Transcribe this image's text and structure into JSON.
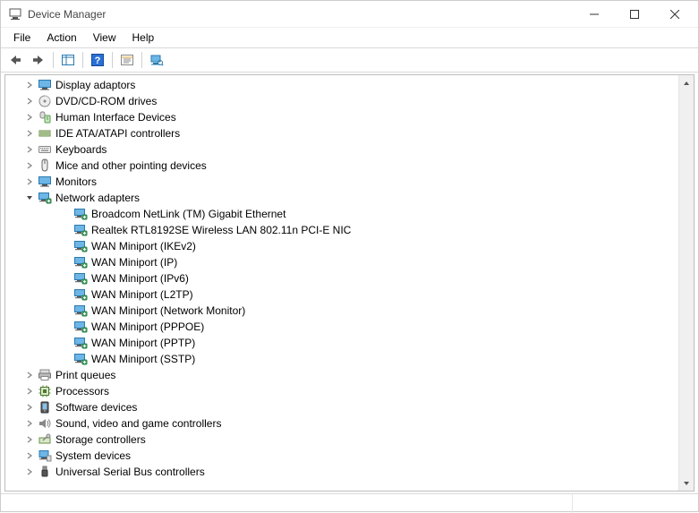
{
  "window": {
    "title": "Device Manager"
  },
  "menu": {
    "file": "File",
    "action": "Action",
    "view": "View",
    "help": "Help"
  },
  "tree": {
    "categories": [
      {
        "label": "Display adaptors",
        "icon": "monitor",
        "expanded": false,
        "children": []
      },
      {
        "label": "DVD/CD-ROM drives",
        "icon": "disc",
        "expanded": false,
        "children": []
      },
      {
        "label": "Human Interface Devices",
        "icon": "hid",
        "expanded": false,
        "children": []
      },
      {
        "label": "IDE ATA/ATAPI controllers",
        "icon": "ide",
        "expanded": false,
        "children": []
      },
      {
        "label": "Keyboards",
        "icon": "keyboard",
        "expanded": false,
        "children": []
      },
      {
        "label": "Mice and other pointing devices",
        "icon": "mouse",
        "expanded": false,
        "children": []
      },
      {
        "label": "Monitors",
        "icon": "monitor",
        "expanded": false,
        "children": []
      },
      {
        "label": "Network adapters",
        "icon": "net",
        "expanded": true,
        "children": [
          {
            "label": "Broadcom NetLink (TM) Gigabit Ethernet",
            "icon": "net"
          },
          {
            "label": "Realtek RTL8192SE Wireless LAN 802.11n PCI-E NIC",
            "icon": "net"
          },
          {
            "label": "WAN Miniport (IKEv2)",
            "icon": "net"
          },
          {
            "label": "WAN Miniport (IP)",
            "icon": "net"
          },
          {
            "label": "WAN Miniport (IPv6)",
            "icon": "net"
          },
          {
            "label": "WAN Miniport (L2TP)",
            "icon": "net"
          },
          {
            "label": "WAN Miniport (Network Monitor)",
            "icon": "net"
          },
          {
            "label": "WAN Miniport (PPPOE)",
            "icon": "net"
          },
          {
            "label": "WAN Miniport (PPTP)",
            "icon": "net"
          },
          {
            "label": "WAN Miniport (SSTP)",
            "icon": "net"
          }
        ]
      },
      {
        "label": "Print queues",
        "icon": "printer",
        "expanded": false,
        "children": []
      },
      {
        "label": "Processors",
        "icon": "cpu",
        "expanded": false,
        "children": []
      },
      {
        "label": "Software devices",
        "icon": "software",
        "expanded": false,
        "children": []
      },
      {
        "label": "Sound, video and game controllers",
        "icon": "sound",
        "expanded": false,
        "children": []
      },
      {
        "label": "Storage controllers",
        "icon": "storage",
        "expanded": false,
        "children": []
      },
      {
        "label": "System devices",
        "icon": "system",
        "expanded": false,
        "children": []
      },
      {
        "label": "Universal Serial Bus controllers",
        "icon": "usb",
        "expanded": false,
        "children": []
      }
    ]
  }
}
